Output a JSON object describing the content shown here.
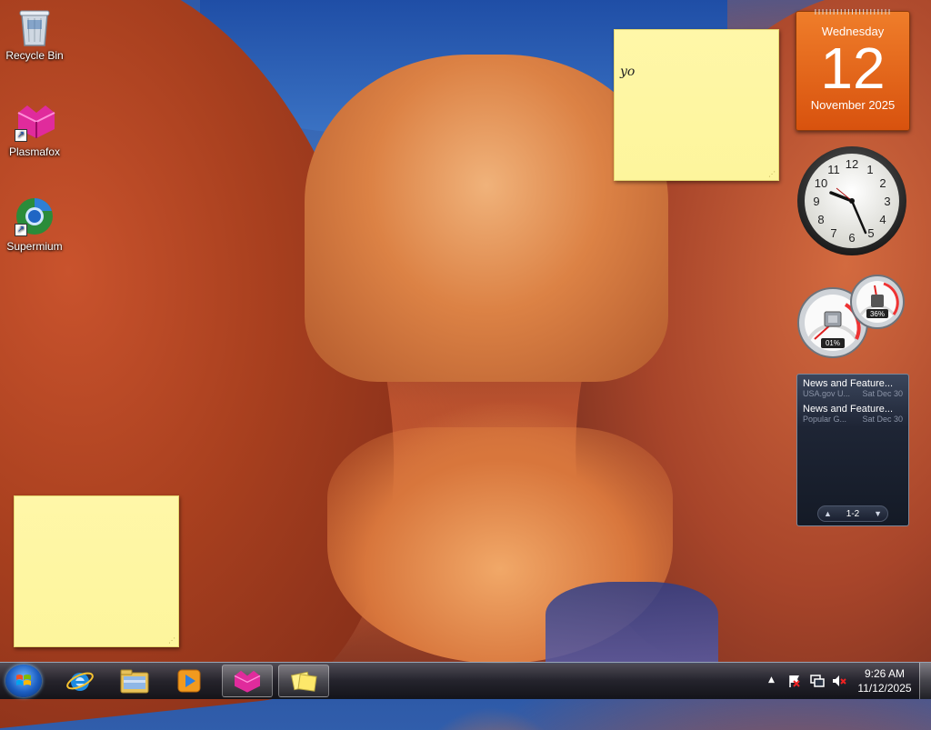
{
  "desktop": {
    "icons": [
      {
        "label": "Recycle Bin",
        "icon": "recycle-bin-icon"
      },
      {
        "label": "Plasmafox",
        "icon": "plasmafox-icon"
      },
      {
        "label": "Supermium",
        "icon": "supermium-icon"
      }
    ],
    "wallpaper": "red sandstone canyon"
  },
  "sticky_notes": [
    {
      "text": "yo"
    },
    {
      "text": ""
    }
  ],
  "gadgets": {
    "calendar": {
      "weekday": "Wednesday",
      "day": "12",
      "month_year": "November 2025"
    },
    "clock": {
      "time_display": "analog"
    },
    "cpu_meter": {
      "cpu": "01%",
      "memory": "36%"
    },
    "feed": {
      "items": [
        {
          "title": "News and Feature...",
          "source": "USA.gov U...",
          "date": "Sat Dec 30"
        },
        {
          "title": "News and Feature...",
          "source": "Popular G...",
          "date": "Sat Dec 30"
        }
      ],
      "pager": "1-2",
      "prev_icon": "▲",
      "next_icon": "▼"
    }
  },
  "taskbar": {
    "start_icon": "windows-start-icon",
    "pinned": [
      {
        "icon": "internet-explorer-icon"
      },
      {
        "icon": "file-explorer-icon"
      },
      {
        "icon": "media-player-icon"
      },
      {
        "icon": "plasmafox-icon",
        "active": true
      },
      {
        "icon": "sticky-notes-icon",
        "active": true
      }
    ],
    "tray": {
      "show_hidden": "▲",
      "time": "9:26 AM",
      "date": "11/12/2025"
    }
  }
}
